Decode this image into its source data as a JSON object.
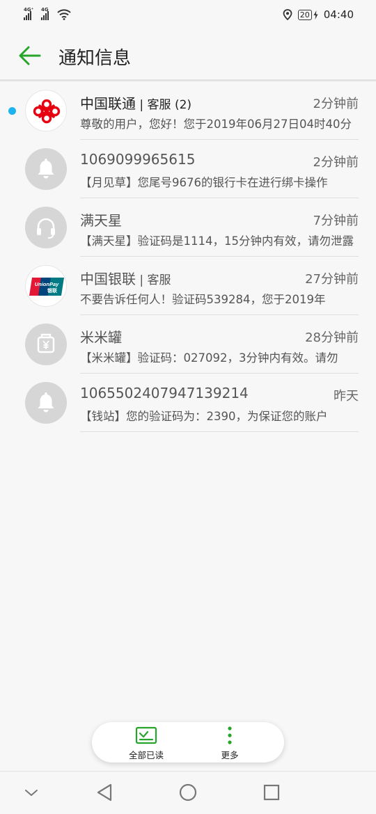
{
  "status_bar": {
    "signal1": "4G⁺",
    "signal2": "4G",
    "battery": "20",
    "time": "04:40",
    "icons": [
      "signal-icon",
      "wifi-icon",
      "location-icon",
      "battery-icon",
      "charging-icon"
    ]
  },
  "header": {
    "title": "通知信息",
    "back_icon": "back-arrow-icon"
  },
  "colors": {
    "accent": "#27a52b",
    "unread_dot": "#1cb3ef",
    "avatar_gray": "#d6d6d6",
    "unicom_red": "#e60012"
  },
  "messages": [
    {
      "sender": "中国联通",
      "sender_sub": " | 客服 (2)",
      "time": "2分钟前",
      "preview": "尊敬的用户，您好！您于2019年06月27日04时40分",
      "unread": true,
      "avatar": "china-unicom-logo"
    },
    {
      "sender": "1069099965615",
      "sender_sub": "",
      "time": "2分钟前",
      "preview": "【月见草】您尾号9676的银行卡在进行绑卡操作",
      "unread": false,
      "avatar": "bell-icon"
    },
    {
      "sender": "满天星",
      "sender_sub": "",
      "time": "7分钟前",
      "preview": "【满天星】验证码是1114，15分钟内有效，请勿泄露",
      "unread": false,
      "avatar": "headset-icon"
    },
    {
      "sender": "中国银联",
      "sender_sub": " | 客服",
      "time": "27分钟前",
      "preview": "不要告诉任何人！验证码539284，您于2019年",
      "unread": false,
      "avatar": "unionpay-logo"
    },
    {
      "sender": "米米罐",
      "sender_sub": "",
      "time": "28分钟前",
      "preview": "【米米罐】验证码：027092，3分钟内有效。请勿",
      "unread": false,
      "avatar": "wallet-icon"
    },
    {
      "sender": "1065502407947139214",
      "sender_sub": "",
      "time": "昨天",
      "preview": "【钱站】您的验证码为：2390，为保证您的账户",
      "unread": false,
      "avatar": "bell-icon"
    }
  ],
  "actions": {
    "mark_all_read": "全部已读",
    "more": "更多"
  },
  "logos": {
    "unionpay_text": "UnionPay",
    "unionpay_cn": "银联"
  },
  "nav": {
    "icons": [
      "collapse-chevron-icon",
      "back-triangle-icon",
      "home-circle-icon",
      "recents-square-icon"
    ]
  }
}
